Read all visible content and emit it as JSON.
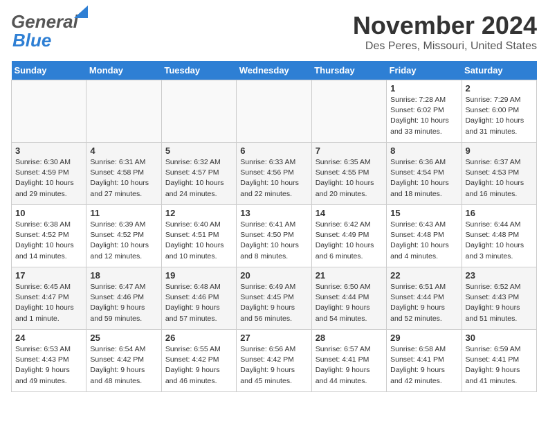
{
  "header": {
    "logo_general": "General",
    "logo_blue": "Blue",
    "month_title": "November 2024",
    "location": "Des Peres, Missouri, United States"
  },
  "calendar": {
    "days_of_week": [
      "Sunday",
      "Monday",
      "Tuesday",
      "Wednesday",
      "Thursday",
      "Friday",
      "Saturday"
    ],
    "weeks": [
      {
        "days": [
          {
            "num": "",
            "info": ""
          },
          {
            "num": "",
            "info": ""
          },
          {
            "num": "",
            "info": ""
          },
          {
            "num": "",
            "info": ""
          },
          {
            "num": "",
            "info": ""
          },
          {
            "num": "1",
            "info": "Sunrise: 7:28 AM\nSunset: 6:02 PM\nDaylight: 10 hours and 33 minutes."
          },
          {
            "num": "2",
            "info": "Sunrise: 7:29 AM\nSunset: 6:00 PM\nDaylight: 10 hours and 31 minutes."
          }
        ]
      },
      {
        "days": [
          {
            "num": "3",
            "info": "Sunrise: 6:30 AM\nSunset: 4:59 PM\nDaylight: 10 hours and 29 minutes."
          },
          {
            "num": "4",
            "info": "Sunrise: 6:31 AM\nSunset: 4:58 PM\nDaylight: 10 hours and 27 minutes."
          },
          {
            "num": "5",
            "info": "Sunrise: 6:32 AM\nSunset: 4:57 PM\nDaylight: 10 hours and 24 minutes."
          },
          {
            "num": "6",
            "info": "Sunrise: 6:33 AM\nSunset: 4:56 PM\nDaylight: 10 hours and 22 minutes."
          },
          {
            "num": "7",
            "info": "Sunrise: 6:35 AM\nSunset: 4:55 PM\nDaylight: 10 hours and 20 minutes."
          },
          {
            "num": "8",
            "info": "Sunrise: 6:36 AM\nSunset: 4:54 PM\nDaylight: 10 hours and 18 minutes."
          },
          {
            "num": "9",
            "info": "Sunrise: 6:37 AM\nSunset: 4:53 PM\nDaylight: 10 hours and 16 minutes."
          }
        ]
      },
      {
        "days": [
          {
            "num": "10",
            "info": "Sunrise: 6:38 AM\nSunset: 4:52 PM\nDaylight: 10 hours and 14 minutes."
          },
          {
            "num": "11",
            "info": "Sunrise: 6:39 AM\nSunset: 4:52 PM\nDaylight: 10 hours and 12 minutes."
          },
          {
            "num": "12",
            "info": "Sunrise: 6:40 AM\nSunset: 4:51 PM\nDaylight: 10 hours and 10 minutes."
          },
          {
            "num": "13",
            "info": "Sunrise: 6:41 AM\nSunset: 4:50 PM\nDaylight: 10 hours and 8 minutes."
          },
          {
            "num": "14",
            "info": "Sunrise: 6:42 AM\nSunset: 4:49 PM\nDaylight: 10 hours and 6 minutes."
          },
          {
            "num": "15",
            "info": "Sunrise: 6:43 AM\nSunset: 4:48 PM\nDaylight: 10 hours and 4 minutes."
          },
          {
            "num": "16",
            "info": "Sunrise: 6:44 AM\nSunset: 4:48 PM\nDaylight: 10 hours and 3 minutes."
          }
        ]
      },
      {
        "days": [
          {
            "num": "17",
            "info": "Sunrise: 6:45 AM\nSunset: 4:47 PM\nDaylight: 10 hours and 1 minute."
          },
          {
            "num": "18",
            "info": "Sunrise: 6:47 AM\nSunset: 4:46 PM\nDaylight: 9 hours and 59 minutes."
          },
          {
            "num": "19",
            "info": "Sunrise: 6:48 AM\nSunset: 4:46 PM\nDaylight: 9 hours and 57 minutes."
          },
          {
            "num": "20",
            "info": "Sunrise: 6:49 AM\nSunset: 4:45 PM\nDaylight: 9 hours and 56 minutes."
          },
          {
            "num": "21",
            "info": "Sunrise: 6:50 AM\nSunset: 4:44 PM\nDaylight: 9 hours and 54 minutes."
          },
          {
            "num": "22",
            "info": "Sunrise: 6:51 AM\nSunset: 4:44 PM\nDaylight: 9 hours and 52 minutes."
          },
          {
            "num": "23",
            "info": "Sunrise: 6:52 AM\nSunset: 4:43 PM\nDaylight: 9 hours and 51 minutes."
          }
        ]
      },
      {
        "days": [
          {
            "num": "24",
            "info": "Sunrise: 6:53 AM\nSunset: 4:43 PM\nDaylight: 9 hours and 49 minutes."
          },
          {
            "num": "25",
            "info": "Sunrise: 6:54 AM\nSunset: 4:42 PM\nDaylight: 9 hours and 48 minutes."
          },
          {
            "num": "26",
            "info": "Sunrise: 6:55 AM\nSunset: 4:42 PM\nDaylight: 9 hours and 46 minutes."
          },
          {
            "num": "27",
            "info": "Sunrise: 6:56 AM\nSunset: 4:42 PM\nDaylight: 9 hours and 45 minutes."
          },
          {
            "num": "28",
            "info": "Sunrise: 6:57 AM\nSunset: 4:41 PM\nDaylight: 9 hours and 44 minutes."
          },
          {
            "num": "29",
            "info": "Sunrise: 6:58 AM\nSunset: 4:41 PM\nDaylight: 9 hours and 42 minutes."
          },
          {
            "num": "30",
            "info": "Sunrise: 6:59 AM\nSunset: 4:41 PM\nDaylight: 9 hours and 41 minutes."
          }
        ]
      }
    ]
  }
}
